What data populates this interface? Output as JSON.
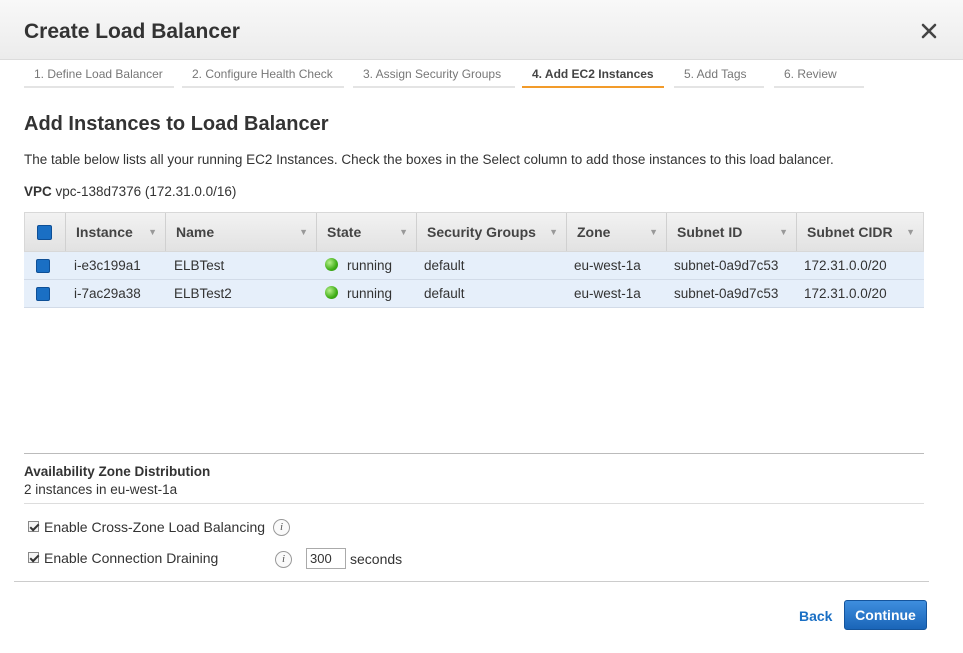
{
  "dialog": {
    "title": "Create Load Balancer"
  },
  "steps": [
    "1. Define Load Balancer",
    "2. Configure Health Check",
    "3. Assign Security Groups",
    "4. Add EC2 Instances",
    "5. Add Tags",
    "6. Review"
  ],
  "active_step": 3,
  "section": {
    "title": "Add Instances to Load Balancer",
    "description": "The table below lists all your running EC2 Instances. Check the boxes in the Select column to add those instances to this load balancer.",
    "vpc_label": "VPC",
    "vpc_value": "vpc-138d7376 (172.31.0.0/16)"
  },
  "table": {
    "columns": [
      "Instance",
      "Name",
      "State",
      "Security Groups",
      "Zone",
      "Subnet ID",
      "Subnet CIDR"
    ],
    "rows": [
      {
        "selected": true,
        "instance": "i-e3c199a1",
        "name": "ELBTest",
        "state": "running",
        "security_groups": "default",
        "zone": "eu-west-1a",
        "subnet_id": "subnet-0a9d7c53",
        "subnet_cidr": "172.31.0.0/20"
      },
      {
        "selected": true,
        "instance": "i-7ac29a38",
        "name": "ELBTest2",
        "state": "running",
        "security_groups": "default",
        "zone": "eu-west-1a",
        "subnet_id": "subnet-0a9d7c53",
        "subnet_cidr": "172.31.0.0/20"
      }
    ]
  },
  "availability": {
    "title": "Availability Zone Distribution",
    "value": "2 instances in eu-west-1a"
  },
  "options": {
    "cross_zone_label": "Enable Cross-Zone Load Balancing",
    "cross_zone_checked": true,
    "draining_label": "Enable Connection Draining",
    "draining_checked": true,
    "draining_timeout": "300",
    "draining_unit": "seconds"
  },
  "footer": {
    "back_label": "Back",
    "continue_label": "Continue"
  },
  "colors": {
    "accent": "#1a6fc4",
    "active_tab": "#f29b2a",
    "row_bg": "#e6effa",
    "status_running": "#3fae17"
  }
}
